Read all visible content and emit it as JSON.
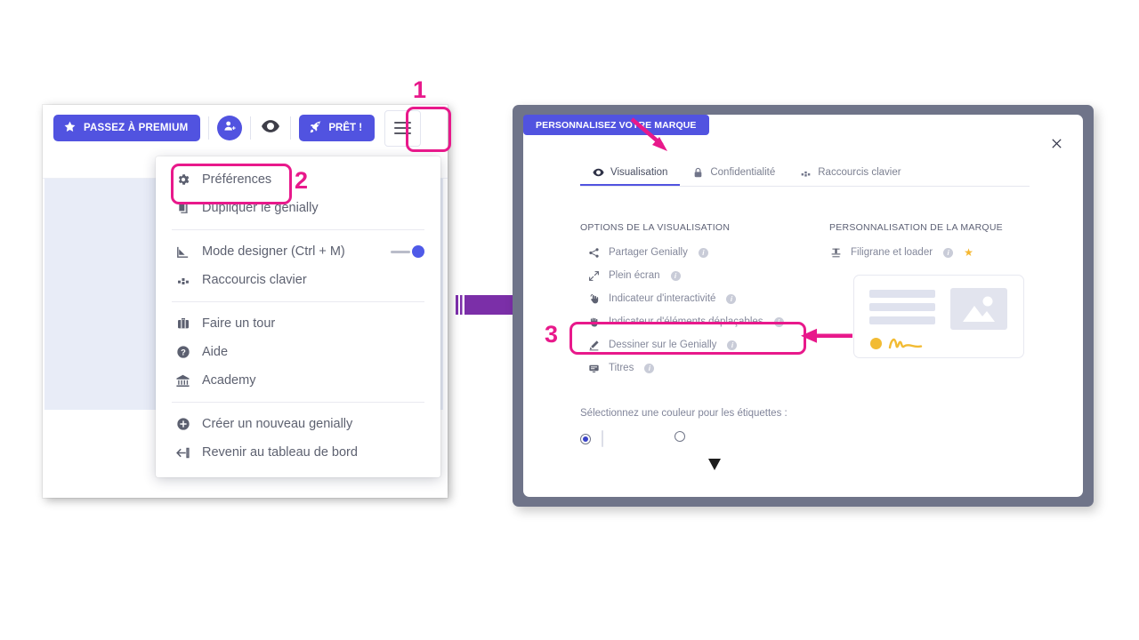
{
  "editor": {
    "toolbar": {
      "premium_label": "PASSEZ À PREMIUM",
      "premium_icon": "star-icon",
      "user_add_icon": "user-add-icon",
      "preview_icon": "eye-icon",
      "ready_label": "PRÊT !",
      "ready_icon": "rocket-icon",
      "menu_icon": "hamburger-menu-icon"
    },
    "menu": {
      "items": [
        {
          "label": "Préférences",
          "icon": "gear-icon",
          "toggle": null
        },
        {
          "label": "Dupliquer le genially",
          "icon": "duplicate-icon",
          "toggle": null
        },
        {
          "label": "Mode designer (Ctrl + M)",
          "icon": "designer-mode-icon",
          "toggle": "on"
        },
        {
          "label": "Raccourcis clavier",
          "icon": "keyboard-shortcuts-icon",
          "toggle": null
        },
        {
          "label": "Faire un tour",
          "icon": "suitcase-icon",
          "toggle": null
        },
        {
          "label": "Aide",
          "icon": "help-circle-icon",
          "toggle": null
        },
        {
          "label": "Academy",
          "icon": "bank-icon",
          "toggle": null
        },
        {
          "label": "Créer un nouveau genially",
          "icon": "plus-circle-icon",
          "toggle": null
        },
        {
          "label": "Revenir au tableau de bord",
          "icon": "back-arrow-icon",
          "toggle": null
        }
      ]
    }
  },
  "dialog": {
    "close_icon": "close-icon",
    "tabs": [
      {
        "label": "Visualisation",
        "icon": "eye-open-icon",
        "active": true
      },
      {
        "label": "Confidentialité",
        "icon": "lock-icon",
        "active": false
      },
      {
        "label": "Raccourcis clavier",
        "icon": "keyboard-shortcuts-icon",
        "active": false
      }
    ],
    "left_column": {
      "title": "OPTIONS DE LA VISUALISATION",
      "options": [
        {
          "label": "Partager Genially",
          "icon": "share-icon",
          "toggle": "on",
          "info": true
        },
        {
          "label": "Plein écran",
          "icon": "fullscreen-icon",
          "toggle": "on",
          "info": true
        },
        {
          "label": "Indicateur d'interactivité",
          "icon": "interactivity-hand-icon",
          "toggle": "off",
          "info": true
        },
        {
          "label": "Indicateur d'éléments déplaçables",
          "icon": "drag-hand-icon",
          "toggle": "off",
          "info": true
        },
        {
          "label": "Dessiner sur le Genially",
          "icon": "pencil-icon",
          "toggle": "on",
          "info": true
        },
        {
          "label": "Titres",
          "icon": "titles-icon",
          "toggle": "on",
          "info": true
        }
      ],
      "color_note": "Sélectionnez une couleur pour les étiquettes :",
      "color_options": [
        {
          "name": "white-label",
          "color": "#ffffff",
          "selected": true
        },
        {
          "name": "black-label",
          "color": "#1d1d1d",
          "selected": false
        }
      ]
    },
    "right_column": {
      "title": "PERSONNALISATION DE LA MARQUE",
      "watermark": {
        "label": "Filigrane et loader",
        "icon": "stamp-icon",
        "toggle": "on",
        "info": true,
        "premium_star": "★"
      },
      "brand_button": "PERSONNALISEZ VOTRE MARQUE",
      "preview_icon": "image-placeholder-icon"
    }
  },
  "annotations": {
    "markers": [
      {
        "number": "1",
        "target": "hamburger-menu-icon"
      },
      {
        "number": "2",
        "target": "preferences-menu-item"
      },
      {
        "number": "3",
        "target": "dessiner-sur-le-genially-row"
      }
    ],
    "accent_color": "#e8198b",
    "flow_arrow_color": "#7b2fa8"
  }
}
